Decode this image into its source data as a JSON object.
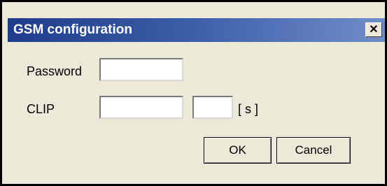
{
  "window": {
    "title": "GSM configuration",
    "close_glyph": "✕"
  },
  "form": {
    "password_label": "Password",
    "password_value": "",
    "clip_label": "CLIP",
    "clip_value": "",
    "clip_seconds_value": "",
    "clip_unit": "[ s ]"
  },
  "buttons": {
    "ok_label": "OK",
    "cancel_label": "Cancel"
  },
  "colors": {
    "title_gradient_start": "#1e3c8a",
    "title_gradient_end": "#6f8ec9",
    "dialog_background": "#ece9d8"
  }
}
